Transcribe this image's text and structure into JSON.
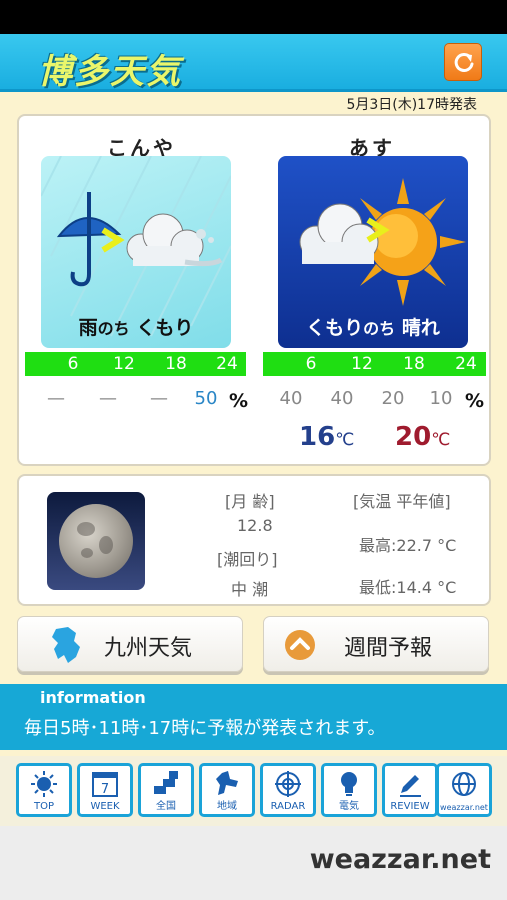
{
  "header": {
    "title": "博多天気"
  },
  "announce": "5月3日(木)17時発表",
  "today": {
    "label": "こんや",
    "weather_main": "雨",
    "weather_joiner": "のち",
    "weather_after": "くもり",
    "times": [
      "6",
      "12",
      "18",
      "24"
    ],
    "pops": [
      "—",
      "—",
      "—",
      "50"
    ],
    "pct": "%"
  },
  "tomorrow": {
    "label": "あす",
    "weather_main": "くもり",
    "weather_joiner": "のち",
    "weather_after": "晴れ",
    "times": [
      "6",
      "12",
      "18",
      "24"
    ],
    "pops": [
      "40",
      "40",
      "20",
      "10"
    ],
    "pct": "%",
    "temp_min": "16",
    "temp_max": "20",
    "temp_unit": "℃"
  },
  "moon": {
    "age_label": "[月 齢]",
    "age_value": "12.8",
    "tide_label": "[潮回り]",
    "tide_value": "中 潮",
    "normal_label": "[気温 平年値]",
    "normal_high": "最高:22.7 °C",
    "normal_low": "最低:14.4 °C"
  },
  "buttons": {
    "kyushu": "九州天気",
    "weekly": "週間予報"
  },
  "info": {
    "title": "information",
    "message": "毎日5時･11時･17時に予報が発表されます。"
  },
  "tabs": [
    {
      "label": "TOP",
      "icon": "sun-icon"
    },
    {
      "label": "WEEK",
      "icon": "calendar-icon",
      "number": "7"
    },
    {
      "label": "全国",
      "icon": "japan-map-icon"
    },
    {
      "label": "地域",
      "icon": "region-map-icon"
    },
    {
      "label": "RADAR",
      "icon": "radar-icon"
    },
    {
      "label": "電気",
      "icon": "lightbulb-icon"
    },
    {
      "label": "REVIEW",
      "icon": "pencil-icon"
    },
    {
      "label": "weazzar.net",
      "icon": "globe-icon"
    }
  ],
  "brand": "weazzar.net",
  "colors": {
    "header": "#1aaee0",
    "accent_green": "#1fde12",
    "info_bar": "#17a8d6",
    "min_temp": "#24408c",
    "max_temp": "#9f1b2e"
  }
}
